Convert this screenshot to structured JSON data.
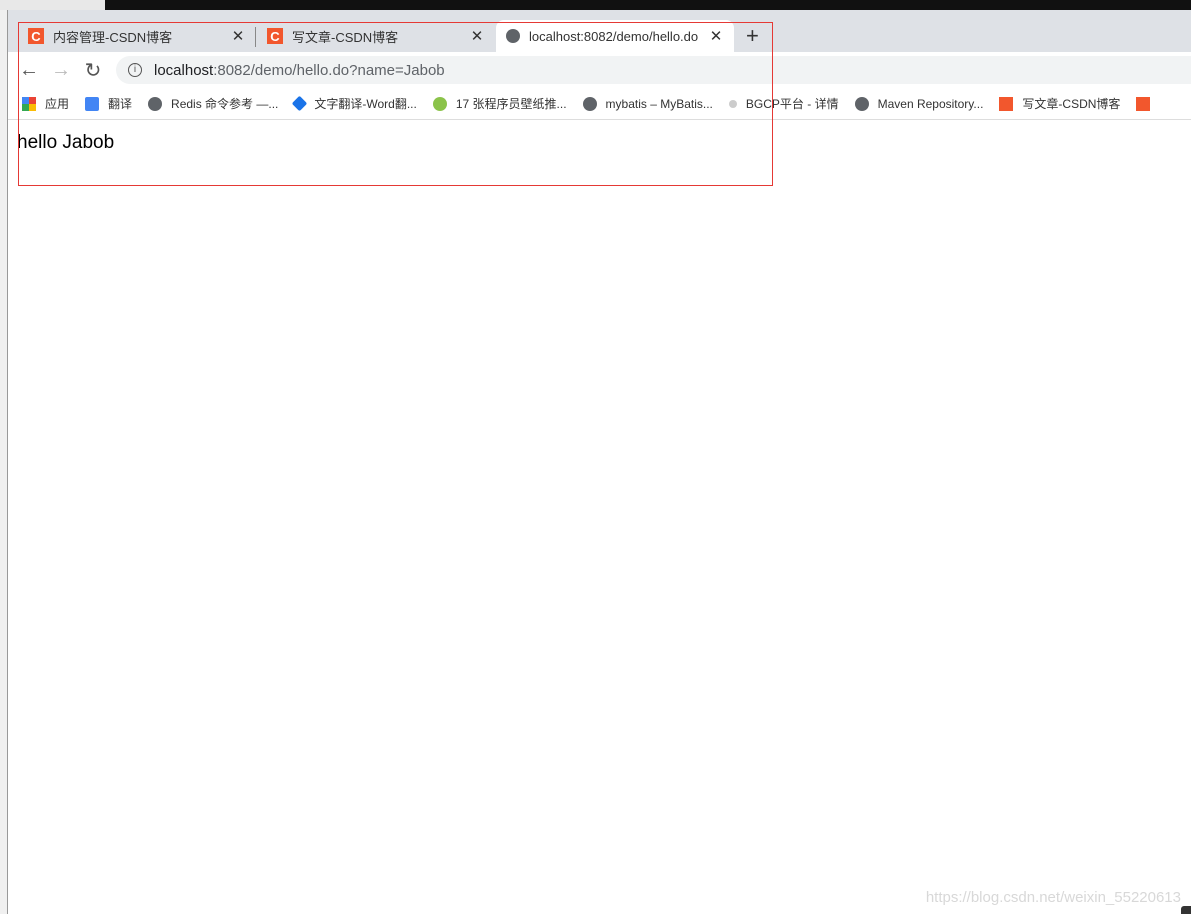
{
  "tabs": [
    {
      "title": "内容管理-CSDN博客",
      "icon": "csdn-icon",
      "active": false
    },
    {
      "title": "写文章-CSDN博客",
      "icon": "csdn-icon",
      "active": false
    },
    {
      "title": "localhost:8082/demo/hello.do",
      "icon": "globe-icon",
      "active": true
    }
  ],
  "close_glyph": "✕",
  "new_tab_glyph": "+",
  "address": {
    "host": "localhost",
    "rest": ":8082/demo/hello.do?name=Jabob"
  },
  "bookmarks": [
    {
      "label": "应用",
      "icon": "apps-icon"
    },
    {
      "label": "翻译",
      "icon": "translate-icon"
    },
    {
      "label": "Redis 命令参考 —...",
      "icon": "globe-icon"
    },
    {
      "label": "文字翻译-Word翻...",
      "icon": "word-icon"
    },
    {
      "label": "17 张程序员壁纸推...",
      "icon": "green-icon"
    },
    {
      "label": "mybatis – MyBatis...",
      "icon": "globe-icon"
    },
    {
      "label": "BGCP平台 - 详情",
      "icon": "faint-icon"
    },
    {
      "label": "Maven Repository...",
      "icon": "globe-icon"
    },
    {
      "label": "写文章-CSDN博客",
      "icon": "csdn-icon"
    }
  ],
  "page": {
    "text": "hello Jabob"
  },
  "watermark": "https://blog.csdn.net/weixin_55220613",
  "colors": {
    "highlight": "#e53935",
    "csdn": "#f2572d"
  }
}
